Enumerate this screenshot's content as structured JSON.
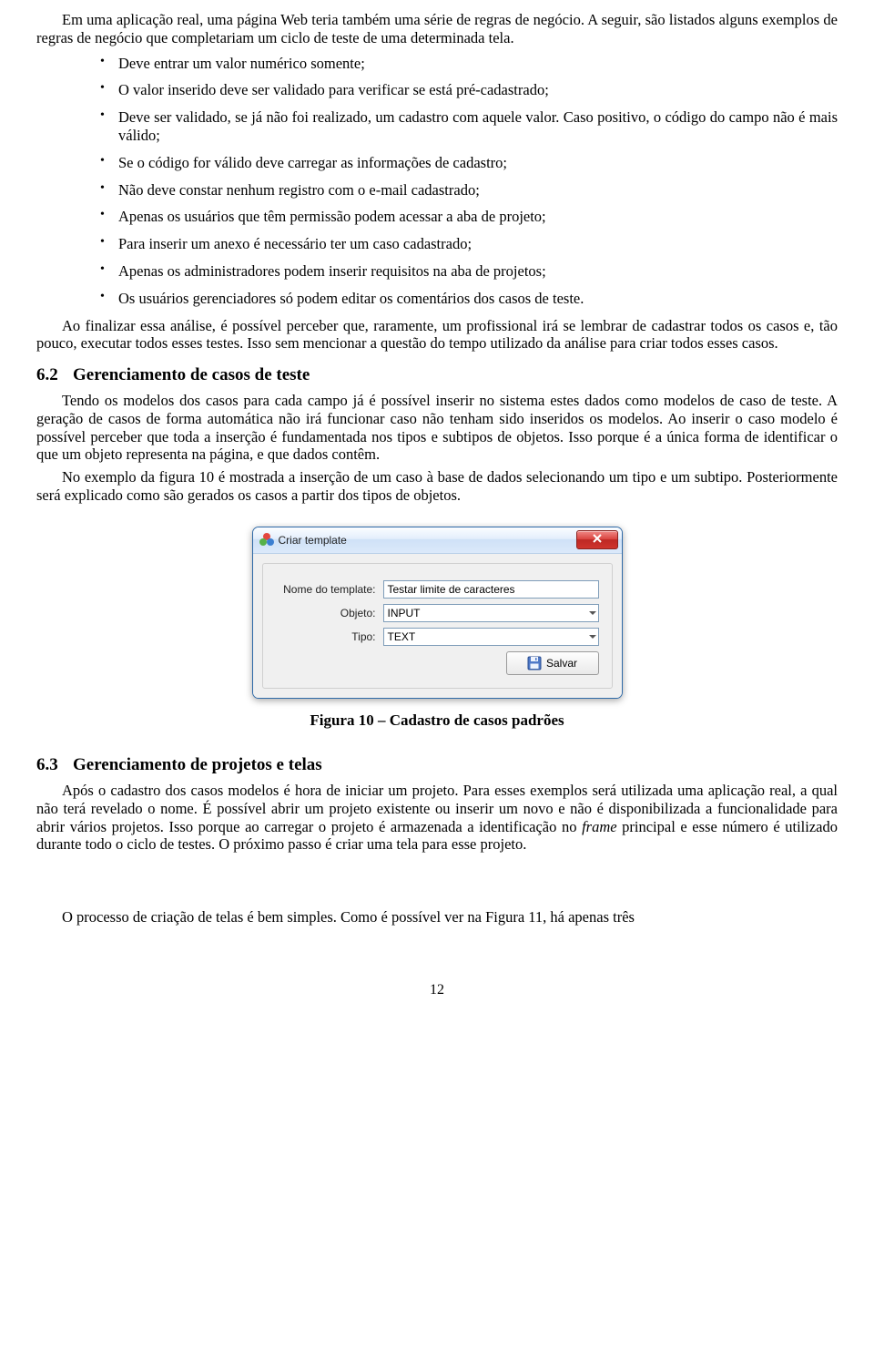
{
  "intro": {
    "p1": "Em uma aplicação real, uma página Web teria também uma série de regras de negócio. A seguir, são listados alguns exemplos de regras de negócio que completariam um ciclo de teste de uma determinada tela."
  },
  "bullets": [
    "Deve entrar um valor numérico somente;",
    "O valor inserido deve ser validado para verificar se está pré-cadastrado;",
    "Deve ser validado, se já não foi realizado, um cadastro com aquele valor. Caso positivo, o código do campo não é mais válido;",
    "Se o código for válido deve carregar as informações de cadastro;",
    "Não deve constar nenhum registro com o e-mail cadastrado;",
    "Apenas os usuários que têm permissão podem acessar a aba de projeto;",
    "Para inserir um anexo é necessário ter um caso cadastrado;",
    "Apenas os administradores podem inserir requisitos na aba de projetos;",
    "Os usuários gerenciadores só podem editar os comentários dos casos de teste."
  ],
  "after_bullets": "Ao finalizar essa análise, é possível perceber que, raramente, um profissional irá se lembrar de cadastrar todos os casos e, tão pouco, executar todos esses testes. Isso sem mencionar a questão do tempo utilizado da análise para criar todos esses casos.",
  "section62": {
    "num": "6.2",
    "title": "Gerenciamento de casos de teste",
    "p1": "Tendo os modelos dos casos para cada campo já é possível inserir no sistema estes dados como modelos de caso de teste. A geração de casos de forma automática não irá funcionar caso não tenham sido inseridos os modelos. Ao inserir o caso modelo é possível perceber que toda a inserção é fundamentada nos tipos e subtipos de objetos. Isso porque é a única forma de identificar o que um objeto representa na página, e que dados contêm.",
    "p2": "No exemplo da figura 10 é mostrada a inserção de um caso à base de dados selecionando um tipo e um subtipo. Posteriormente será explicado como são gerados os casos a partir dos tipos de objetos."
  },
  "dialog": {
    "title": "Criar template",
    "labels": {
      "nome": "Nome do template:",
      "objeto": "Objeto:",
      "tipo": "Tipo:"
    },
    "values": {
      "nome": "Testar limite de caracteres",
      "objeto": "INPUT",
      "tipo": "TEXT"
    },
    "save_label": "Salvar"
  },
  "figure_caption": "Figura 10 – Cadastro de casos padrões",
  "section63": {
    "num": "6.3",
    "title": "Gerenciamento de projetos e telas",
    "p1_prefix": "Após o cadastro dos casos modelos é hora de iniciar um projeto. Para esses exemplos será utilizada uma aplicação real, a qual não terá revelado o nome. É possível abrir um projeto existente ou inserir um novo e não é disponibilizada a funcionalidade para abrir vários projetos. Isso porque ao carregar o projeto é armazenada a identificação no ",
    "p1_italic": "frame",
    "p1_suffix": " principal e esse número é utilizado durante todo o ciclo de testes. O próximo passo é criar uma tela para esse projeto.",
    "p2": "O processo de criação de telas é bem simples.  Como é possível ver na Figura 11, há apenas três"
  },
  "page_number": "12"
}
